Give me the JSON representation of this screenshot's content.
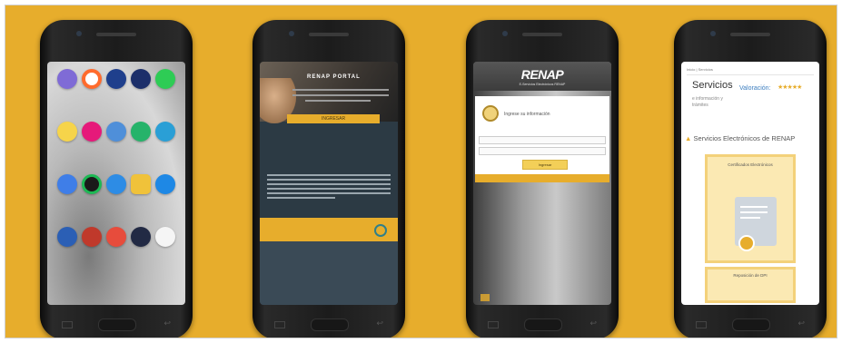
{
  "colors": {
    "background": "#e7ad2c",
    "accent": "#e7ad2c",
    "link": "#3b7dbf"
  },
  "phone2": {
    "title": "RENAP PORTAL",
    "button_label": "INGRESAR"
  },
  "phone3": {
    "brand": "RENAP",
    "subtitle": "E-Servicios Electrónicos RENAP",
    "login_title": "Ingrese su información",
    "button_label": "Ingresar"
  },
  "phone4": {
    "breadcrumb": "Inicio   |   Servicios",
    "heading": "Servicios",
    "rating_label": "Valoración:",
    "rating_stars": "★★★★★",
    "info_line1": "e información y",
    "info_line2": "trámites",
    "section_title": "Servicios Electrónicos de RENAP",
    "card1_title": "Certificados Electrónicos",
    "card2_title": "Reposición de DPI"
  }
}
